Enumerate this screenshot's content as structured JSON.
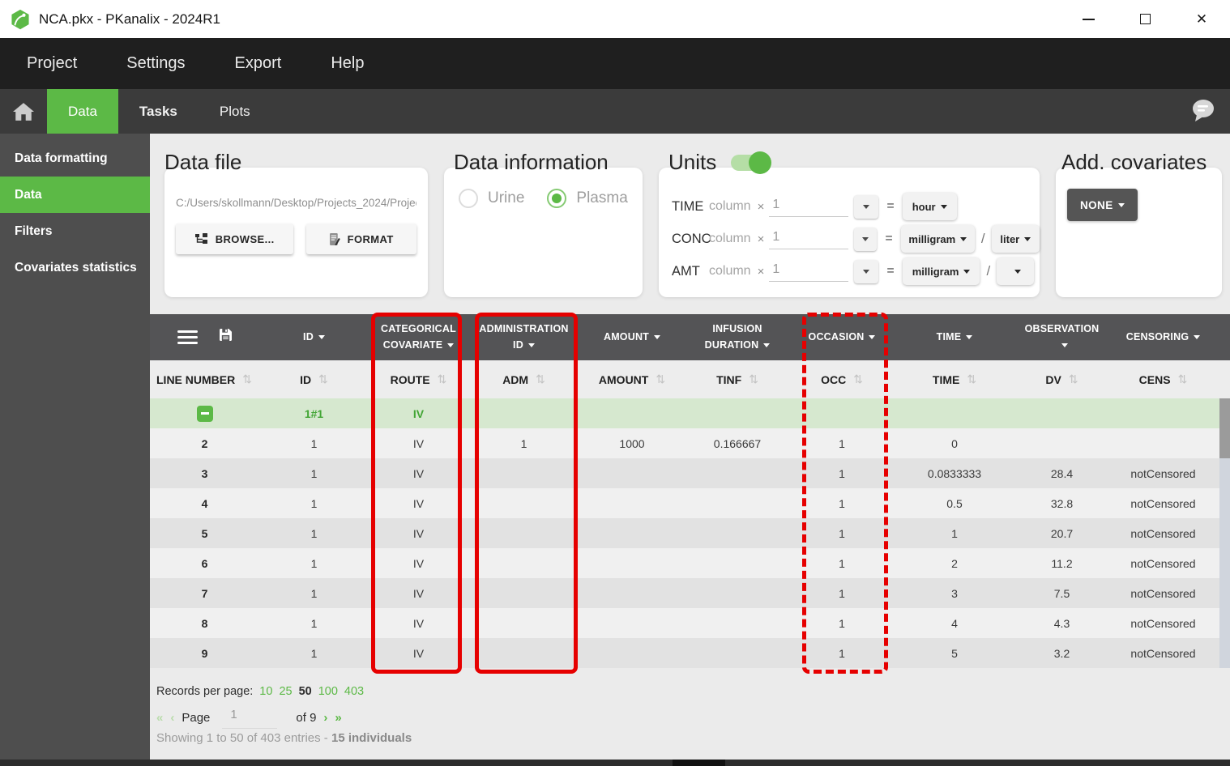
{
  "window": {
    "title": "NCA.pkx - PKanalix - 2024R1"
  },
  "menubar": {
    "items": [
      "Project",
      "Settings",
      "Export",
      "Help"
    ]
  },
  "tabbar": {
    "tabs": [
      {
        "label": "Data",
        "active": true
      },
      {
        "label": "Tasks",
        "active": false
      },
      {
        "label": "Plots",
        "active": false
      }
    ]
  },
  "sidebar": {
    "items": [
      {
        "label": "Data formatting",
        "active": false
      },
      {
        "label": "Data",
        "active": true
      },
      {
        "label": "Filters",
        "active": false
      },
      {
        "label": "Covariates statistics",
        "active": false
      }
    ]
  },
  "panels": {
    "data_file": {
      "title": "Data file",
      "path": "C:/Users/skollmann/Desktop/Projects_2024/Projec...",
      "browse_label": "BROWSE...",
      "format_label": "FORMAT"
    },
    "data_information": {
      "title": "Data information",
      "options": [
        {
          "label": "Urine",
          "selected": false
        },
        {
          "label": "Plasma",
          "selected": true
        }
      ]
    },
    "units": {
      "title": "Units",
      "toggle_on": true,
      "symbols": {
        "times": "×",
        "equals": "=",
        "slash": "/"
      },
      "column_label": "column",
      "rows": [
        {
          "label": "TIME",
          "factor": "1",
          "unit1": "hour"
        },
        {
          "label": "CONC",
          "factor": "1",
          "unit1": "milligram",
          "unit2": "liter"
        },
        {
          "label": "AMT",
          "factor": "1",
          "unit1": "milligram",
          "unit2": ""
        }
      ]
    },
    "add_covariates": {
      "title": "Add. covariates",
      "button_label": "NONE"
    }
  },
  "table": {
    "header": [
      "ID",
      "CATEGORICAL COVARIATE",
      "ADMINISTRATION ID",
      "AMOUNT",
      "INFUSION DURATION",
      "OCCASION",
      "TIME",
      "OBSERVATION",
      "CENSORING"
    ],
    "subheader": [
      "LINE NUMBER",
      "ID",
      "ROUTE",
      "ADM",
      "AMOUNT",
      "TINF",
      "OCC",
      "TIME",
      "DV",
      "CENS"
    ],
    "rows": [
      {
        "line": "",
        "id": "1#1",
        "route": "IV",
        "adm": "",
        "amount": "",
        "tinf": "",
        "occ": "",
        "time": "",
        "dv": "",
        "cens": "",
        "highlight": true,
        "collapse_icon": true
      },
      {
        "line": "2",
        "id": "1",
        "route": "IV",
        "adm": "1",
        "amount": "1000",
        "tinf": "0.166667",
        "occ": "1",
        "time": "0",
        "dv": "",
        "cens": "",
        "shade": "light"
      },
      {
        "line": "3",
        "id": "1",
        "route": "IV",
        "adm": "",
        "amount": "",
        "tinf": "",
        "occ": "1",
        "time": "0.0833333",
        "dv": "28.4",
        "cens": "notCensored",
        "shade": "dark"
      },
      {
        "line": "4",
        "id": "1",
        "route": "IV",
        "adm": "",
        "amount": "",
        "tinf": "",
        "occ": "1",
        "time": "0.5",
        "dv": "32.8",
        "cens": "notCensored",
        "shade": "light"
      },
      {
        "line": "5",
        "id": "1",
        "route": "IV",
        "adm": "",
        "amount": "",
        "tinf": "",
        "occ": "1",
        "time": "1",
        "dv": "20.7",
        "cens": "notCensored",
        "shade": "dark"
      },
      {
        "line": "6",
        "id": "1",
        "route": "IV",
        "adm": "",
        "amount": "",
        "tinf": "",
        "occ": "1",
        "time": "2",
        "dv": "11.2",
        "cens": "notCensored",
        "shade": "light"
      },
      {
        "line": "7",
        "id": "1",
        "route": "IV",
        "adm": "",
        "amount": "",
        "tinf": "",
        "occ": "1",
        "time": "3",
        "dv": "7.5",
        "cens": "notCensored",
        "shade": "dark"
      },
      {
        "line": "8",
        "id": "1",
        "route": "IV",
        "adm": "",
        "amount": "",
        "tinf": "",
        "occ": "1",
        "time": "4",
        "dv": "4.3",
        "cens": "notCensored",
        "shade": "light"
      },
      {
        "line": "9",
        "id": "1",
        "route": "IV",
        "adm": "",
        "amount": "",
        "tinf": "",
        "occ": "1",
        "time": "5",
        "dv": "3.2",
        "cens": "notCensored",
        "shade": "dark"
      }
    ]
  },
  "footer": {
    "records_label": "Records per page:",
    "page_sizes": [
      {
        "value": "10",
        "active": false
      },
      {
        "value": "25",
        "active": false
      },
      {
        "value": "50",
        "active": true
      },
      {
        "value": "100",
        "active": false
      },
      {
        "value": "403",
        "active": false
      }
    ],
    "first_label": "«",
    "prev_label": "‹",
    "page_label": "Page",
    "page_value": "1",
    "of_label": "of 9",
    "next_label": "›",
    "last_label": "»",
    "showing_text": "Showing 1 to 50 of 403 entries - ",
    "individuals_text": "15 individuals"
  },
  "colors": {
    "accent_green": "#5cb946",
    "annotation_red": "#e60000",
    "row_green": "#d6e8cf"
  }
}
